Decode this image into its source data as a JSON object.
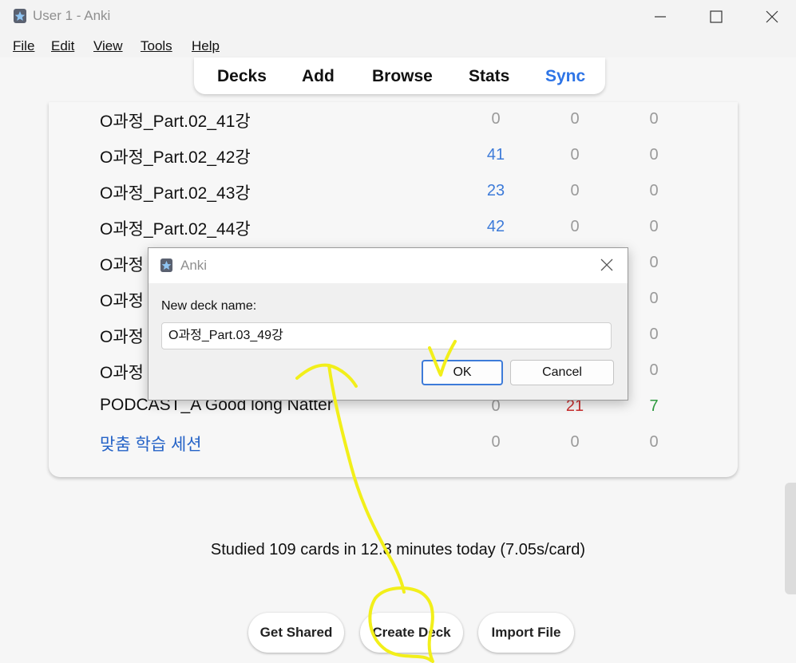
{
  "window": {
    "title": "User 1 - Anki"
  },
  "menu": {
    "file": "File",
    "edit": "Edit",
    "view": "View",
    "tools": "Tools",
    "help": "Help"
  },
  "toolbar": {
    "decks": "Decks",
    "add": "Add",
    "browse": "Browse",
    "stats": "Stats",
    "sync": "Sync",
    "sync_color": "#2d74e6"
  },
  "decks": [
    {
      "name": "O과정_Part.02_41강",
      "new": "0",
      "learn": "0",
      "due": "0"
    },
    {
      "name": "O과정_Part.02_42강",
      "new": "41",
      "learn": "0",
      "due": "0"
    },
    {
      "name": "O과정_Part.02_43강",
      "new": "23",
      "learn": "0",
      "due": "0"
    },
    {
      "name": "O과정_Part.02_44강",
      "new": "42",
      "learn": "0",
      "due": "0"
    },
    {
      "name": "O과정",
      "due": "0"
    },
    {
      "name": "O과정",
      "due": "0"
    },
    {
      "name": "O과정",
      "due": "0"
    },
    {
      "name": "O과정",
      "due": "0"
    },
    {
      "name": "PODCAST_A Good long Natter",
      "new": "0",
      "learn": "21",
      "due": "7"
    },
    {
      "name": "맞춤 학습 세션",
      "new": "0",
      "learn": "0",
      "due": "0"
    }
  ],
  "stats": {
    "text": "Studied 109 cards in 12.8 minutes today (7.05s/card)"
  },
  "buttons": {
    "get_shared": "Get Shared",
    "create_deck": "Create Deck",
    "import_file": "Import File"
  },
  "dialog": {
    "title": "Anki",
    "label": "New deck name:",
    "input_value": "O과정_Part.03_49강",
    "ok": "OK",
    "cancel": "Cancel"
  },
  "colors": {
    "new": "#3d7bd9",
    "learn": "#cc2e2e",
    "due": "#2e9a3f",
    "link": "#2563c7",
    "annotation": "#f2ef1a"
  }
}
